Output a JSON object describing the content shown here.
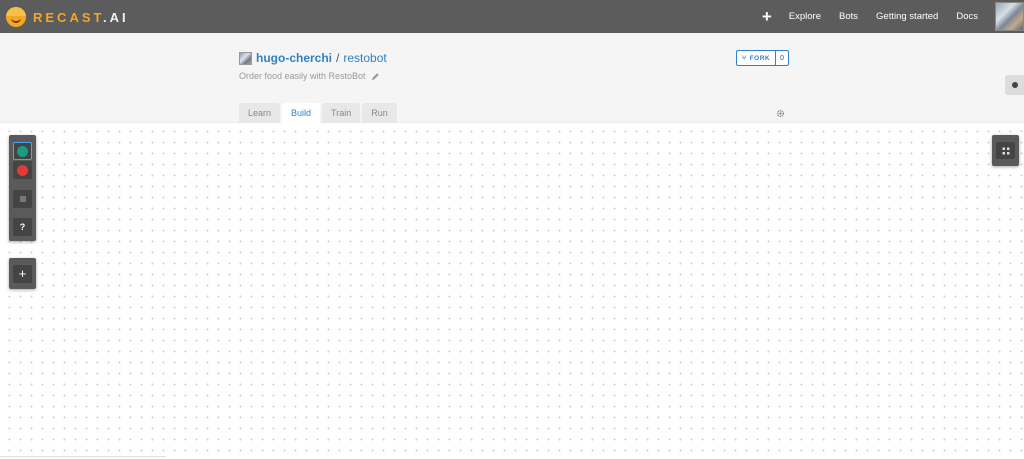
{
  "app": {
    "logo_brand": "RECAST",
    "logo_suffix": ".AI"
  },
  "nav": {
    "add_label": "+",
    "links": [
      "Explore",
      "Bots",
      "Getting started",
      "Docs"
    ],
    "avatar_icon": "user-avatar"
  },
  "repo": {
    "owner": "hugo-cherchi",
    "separator": "/",
    "name": "restobot",
    "description": "Order food easily with RestoBot",
    "fork_label": "FORK",
    "fork_count": "0"
  },
  "tabs": [
    {
      "label": "Learn",
      "active": false
    },
    {
      "label": "Build",
      "active": true
    },
    {
      "label": "Train",
      "active": false
    },
    {
      "label": "Run",
      "active": false
    }
  ],
  "toolbox": {
    "tools": [
      {
        "name": "green-node-tool",
        "color": "#1a9a80",
        "selected": true
      },
      {
        "name": "red-node-tool",
        "color": "#e53935",
        "selected": false
      },
      {
        "name": "gray-node-tool",
        "color": "#777777",
        "selected": false
      },
      {
        "name": "help-tool",
        "glyph": "?"
      }
    ],
    "add_glyph": "+"
  },
  "colors": {
    "navbar": "#5c5c5c",
    "brand": "#f5a623",
    "link": "#2f82c7",
    "canvas_dot": "#cfcfcf"
  }
}
